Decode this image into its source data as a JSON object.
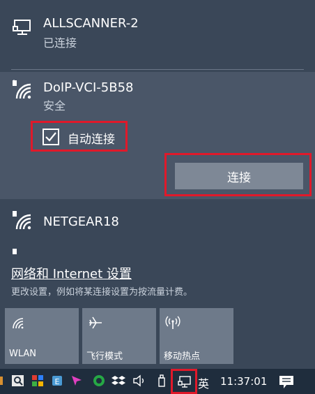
{
  "networks": [
    {
      "name": "ALLSCANNER-2",
      "status": "已连接",
      "icon": "ethernet-monitor-icon"
    },
    {
      "name": "DoIP-VCI-5B58",
      "status": "安全",
      "icon": "wifi-secure-icon"
    },
    {
      "name": "NETGEAR18",
      "icon": "wifi-secure-icon"
    }
  ],
  "autoconnect": {
    "label": "自动连接",
    "checked": true
  },
  "connect_button": {
    "label": "连接"
  },
  "settings": {
    "link": "网络和 Internet 设置",
    "description": "更改设置，例如将某连接设置为按流量计费。"
  },
  "tiles": [
    {
      "label": "WLAN",
      "icon": "wifi-icon"
    },
    {
      "label": "飞行模式",
      "icon": "airplane-icon"
    },
    {
      "label": "移动热点",
      "icon": "hotspot-icon"
    }
  ],
  "taskbar": {
    "language": "英",
    "clock": "11:37:01"
  },
  "colors": {
    "highlight_border": "#e0192a",
    "flyout_bg": "#3a4758",
    "selected_bg": "#4a5668",
    "taskbar_bg": "#1f2d3d"
  }
}
